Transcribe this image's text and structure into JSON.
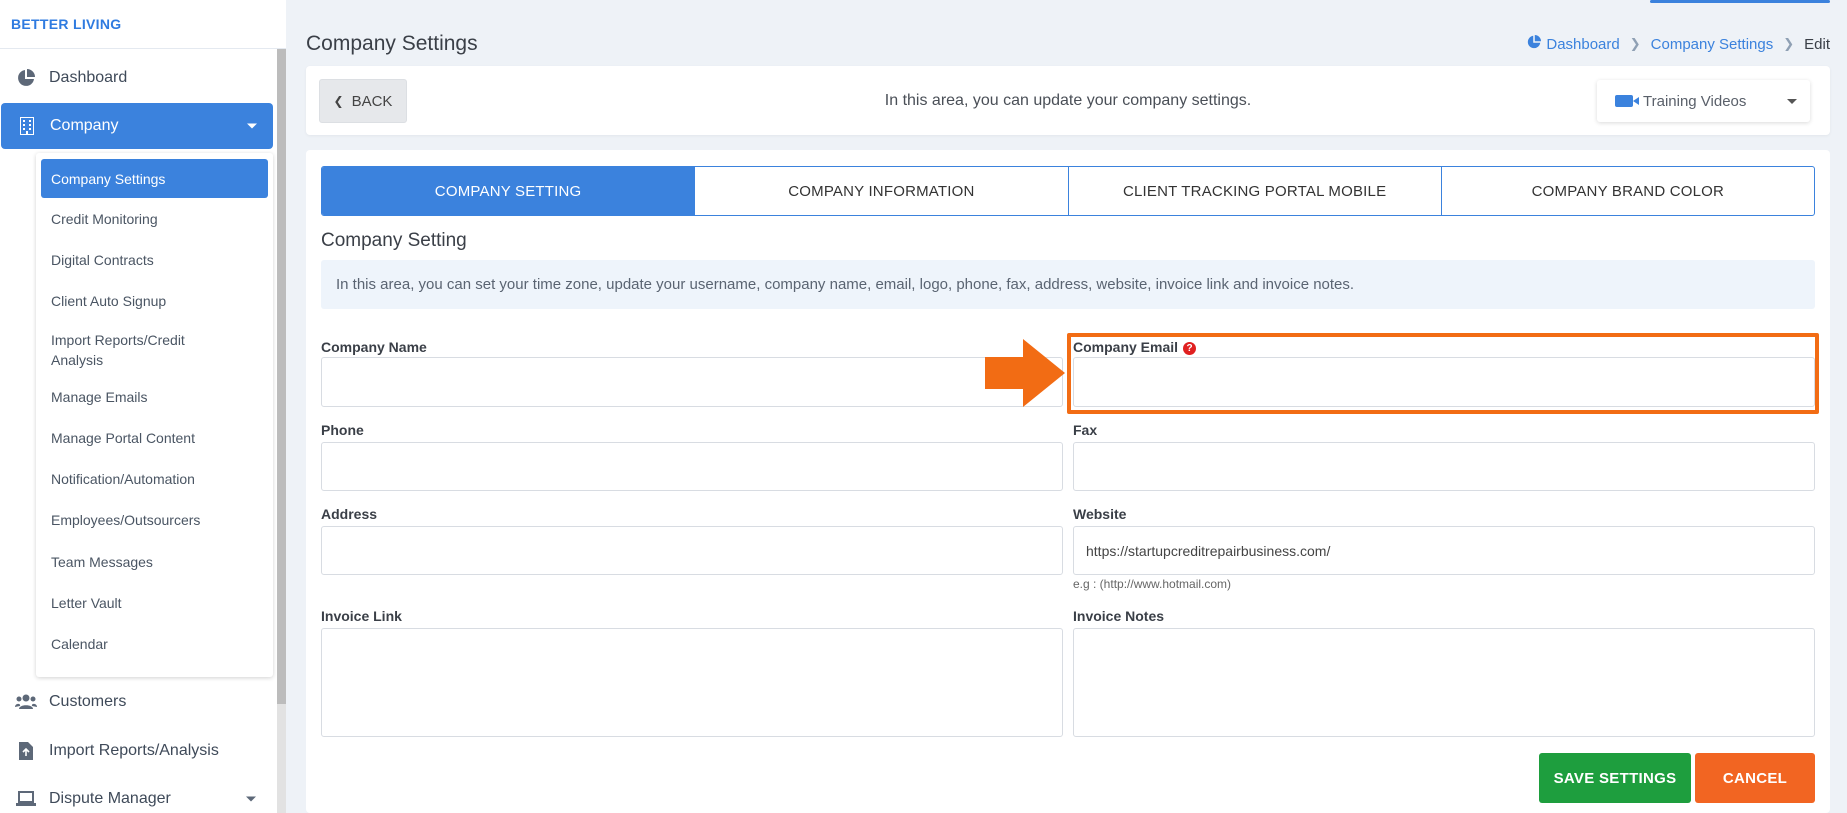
{
  "brand": "BETTER LIVING",
  "sidebar": {
    "items": [
      {
        "label": "Dashboard",
        "icon": "pie-chart-icon"
      },
      {
        "label": "Company",
        "icon": "building-icon"
      },
      {
        "label": "Customers",
        "icon": "users-icon"
      },
      {
        "label": "Import Reports/Analysis",
        "icon": "file-import-icon"
      },
      {
        "label": "Dispute Manager",
        "icon": "laptop-icon"
      }
    ],
    "submenu": [
      "Company Settings",
      "Credit Monitoring",
      "Digital Contracts",
      "Client Auto Signup",
      "Import Reports/Credit Analysis",
      "Manage Emails",
      "Manage Portal Content",
      "Notification/Automation",
      "Employees/Outsourcers",
      "Team Messages",
      "Letter Vault",
      "Calendar"
    ]
  },
  "header": {
    "title": "Company Settings",
    "breadcrumb": [
      "Dashboard",
      "Company Settings",
      "Edit"
    ]
  },
  "topbar": {
    "back_label": "BACK",
    "message": "In this area, you can update your company settings.",
    "training_label": "Training Videos"
  },
  "tabs": [
    "COMPANY SETTING",
    "COMPANY INFORMATION",
    "CLIENT TRACKING PORTAL MOBILE",
    "COMPANY BRAND COLOR"
  ],
  "section": {
    "title": "Company Setting",
    "info": "In this area, you can set your time zone, update your username, company name, email, logo, phone, fax, address, website, invoice link and invoice notes."
  },
  "form": {
    "company_name_label": "Company Name",
    "company_name_value": "",
    "company_email_label": "Company Email",
    "company_email_value": "",
    "phone_label": "Phone",
    "phone_value": "",
    "fax_label": "Fax",
    "fax_value": "",
    "address_label": "Address",
    "address_value": "",
    "website_label": "Website",
    "website_value": "https://startupcreditrepairbusiness.com/",
    "website_hint": "e.g : (http://www.hotmail.com)",
    "invoice_link_label": "Invoice Link",
    "invoice_notes_label": "Invoice Notes"
  },
  "buttons": {
    "save": "SAVE SETTINGS",
    "cancel": "CANCEL"
  },
  "colors": {
    "primary": "#3b82dd",
    "save": "#1e9e3e",
    "cancel": "#f26522",
    "highlight": "#f26c14"
  }
}
